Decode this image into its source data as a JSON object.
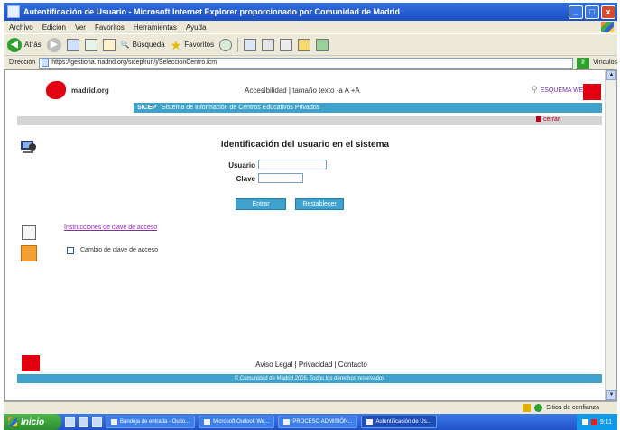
{
  "window": {
    "title": "Autentificación de Usuario - Microsoft Internet Explorer proporcionado por Comunidad de Madrid",
    "minimize": "_",
    "maximize": "□",
    "close": "x"
  },
  "menu": [
    "Archivo",
    "Edición",
    "Ver",
    "Favoritos",
    "Herramientas",
    "Ayuda"
  ],
  "toolbar": {
    "back_label": "Atrás",
    "search_label": "Búsqueda",
    "favorites_label": "Favoritos"
  },
  "address": {
    "label": "Dirección",
    "url": "https://gestiona.madrid.org/sicep/run/j/SeleccionCentro.icm",
    "go_label": "Ir",
    "links_label": "Vínculos"
  },
  "page": {
    "logo_text": "madrid.org",
    "accessibility": "Accesibilidad | tamaño texto  -a  A  +A",
    "help_link": "ESQUEMA WEB",
    "banner_acronym": "SICEP",
    "banner_text": "Sistema de Información de Centros Educativos Privados",
    "close_link": "cerrar",
    "login_title": "Identificación del usuario en el sistema",
    "user_label": "Usuario",
    "password_label": "Clave",
    "enter_button": "Entrar",
    "reset_button": "Restablecer",
    "forgot_link": "Instrucciones de clave de acceso",
    "change_label": "Cambio de clave de acceso",
    "footer_links": "Aviso Legal  |  Privacidad  |  Contacto",
    "footer_bar": "© Comunidad de Madrid 2005. Todos los derechos reservados"
  },
  "status": {
    "zone": "Sitios de confianza"
  },
  "taskbar": {
    "start": "Inicio",
    "tasks": [
      "Bandeja de entrada - Outlo...",
      "Microsoft Outlook We...",
      "PROCESO ADMISIÓN...",
      "Autentificación de Us..."
    ],
    "time": "9:11"
  }
}
